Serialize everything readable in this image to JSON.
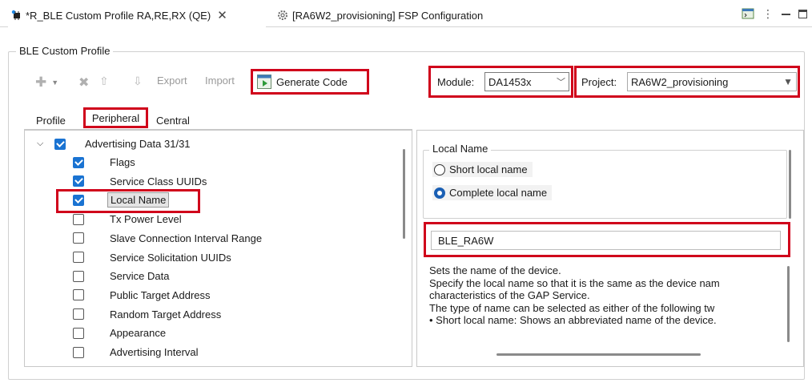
{
  "tabs": [
    {
      "label": "*R_BLE Custom Profile RA,RE,RX (QE)",
      "active": true
    },
    {
      "label": "[RA6W2_provisioning] FSP Configuration",
      "active": false
    }
  ],
  "group_title": "BLE Custom Profile",
  "toolbar": {
    "export_label": "Export",
    "import_label": "Import",
    "generate_label": "Generate Code"
  },
  "module": {
    "label": "Module:",
    "value": "DA1453x"
  },
  "project": {
    "label": "Project:",
    "value": "RA6W2_provisioning"
  },
  "subtabs": [
    "Profile",
    "Peripheral",
    "Central"
  ],
  "tree": {
    "root": "Advertising Data 31/31",
    "items": [
      {
        "label": "Flags",
        "checked": true
      },
      {
        "label": "Service Class UUIDs",
        "checked": true
      },
      {
        "label": "Local Name",
        "checked": true
      },
      {
        "label": "Tx Power Level",
        "checked": false
      },
      {
        "label": "Slave Connection Interval Range",
        "checked": false
      },
      {
        "label": "Service Solicitation UUIDs",
        "checked": false
      },
      {
        "label": "Service Data",
        "checked": false
      },
      {
        "label": "Public Target Address",
        "checked": false
      },
      {
        "label": "Random Target Address",
        "checked": false
      },
      {
        "label": "Appearance",
        "checked": false
      },
      {
        "label": "Advertising Interval",
        "checked": false
      }
    ]
  },
  "detail": {
    "section_title": "Local Name",
    "radio_short": "Short local name",
    "radio_complete": "Complete local name",
    "name_value": "BLE_RA6W",
    "description": [
      "Sets the name of the device.",
      "Specify the local name so that it is the same as the device nam",
      "characteristics of the GAP Service.",
      "The type of name can be selected as either of the following tw",
      "• Short local name: Shows an abbreviated name of the device."
    ]
  },
  "colors": {
    "highlight": "#d0021b",
    "accent": "#1a73d2"
  }
}
